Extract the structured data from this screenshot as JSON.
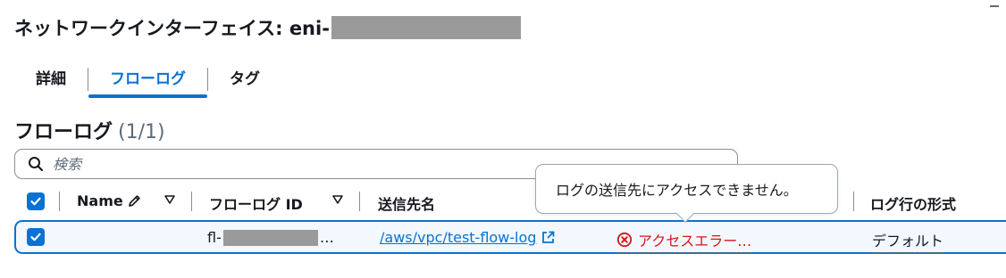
{
  "header": {
    "title_prefix": "ネットワークインターフェイス: eni-"
  },
  "tabs": [
    {
      "label": "詳細",
      "active": false
    },
    {
      "label": "フローログ",
      "active": true
    },
    {
      "label": "タグ",
      "active": false
    }
  ],
  "section": {
    "title": "フローログ",
    "count": "(1/1)"
  },
  "search": {
    "placeholder": "検索",
    "value": ""
  },
  "table": {
    "columns": {
      "name": "Name",
      "flow_log_id": "フローログ ID",
      "destination": "送信先名",
      "log_format": "ログ行の形式"
    },
    "rows": [
      {
        "selected": true,
        "name": "",
        "flow_log_id_prefix": "fl-",
        "flow_log_id_suffix": "…",
        "destination": "/aws/vpc/test-flow-log",
        "status": "アクセスエラー…",
        "log_format": "デフォルト"
      }
    ]
  },
  "tooltip": {
    "text": "ログの送信先にアクセスできません。"
  },
  "colors": {
    "accent": "#0972d3",
    "error": "#d91515",
    "text": "#16191f",
    "redaction": "#9a9a9a"
  },
  "icons": [
    "search-icon",
    "check-icon",
    "edit-icon",
    "sort-down-icon",
    "external-link-icon",
    "error-icon"
  ]
}
